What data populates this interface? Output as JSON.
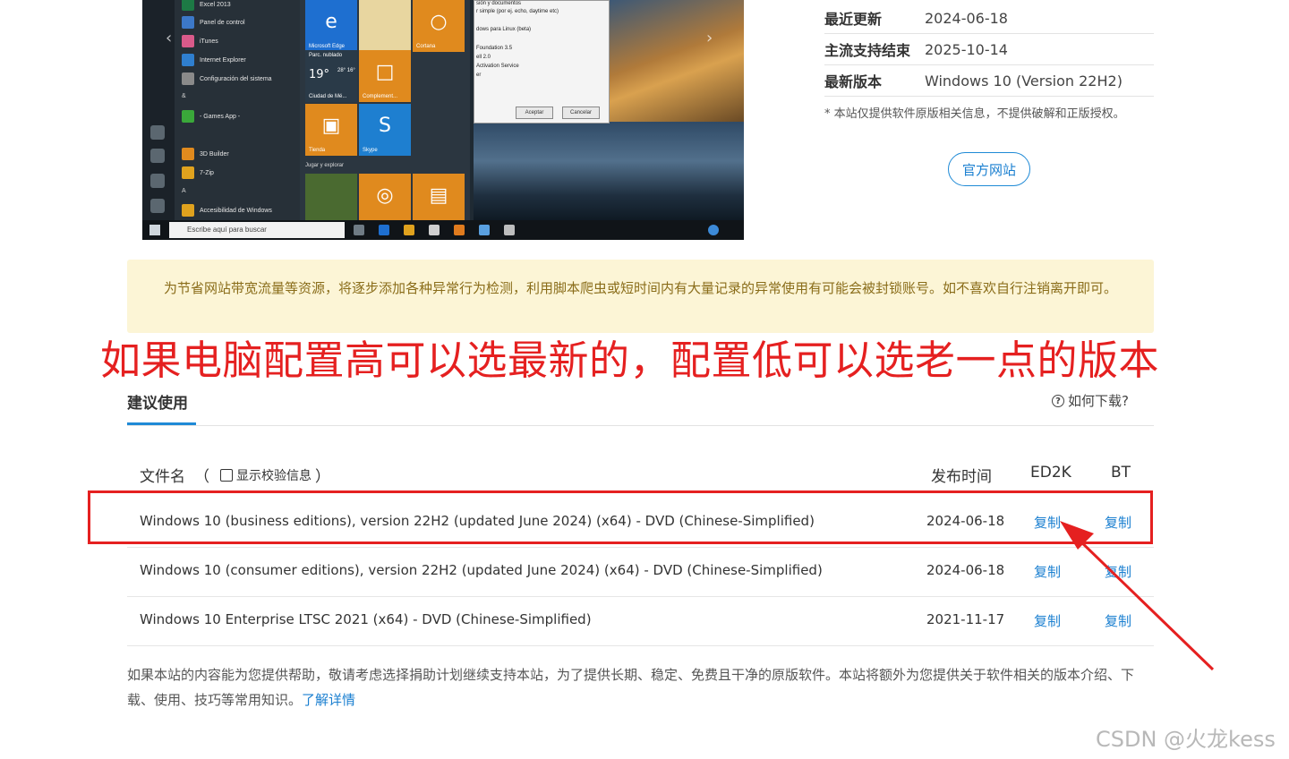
{
  "screenshot": {
    "apps": [
      {
        "label": "Excel 2013",
        "color": "#1d7a45"
      },
      {
        "label": "Panel de control",
        "color": "#3c78c8"
      },
      {
        "label": "iTunes",
        "color": "#d95a8a"
      },
      {
        "label": "Internet Explorer",
        "color": "#2f7fcf"
      },
      {
        "label": "Configuración del sistema",
        "color": "#8a8a8a"
      },
      {
        "label": "- Games App -",
        "color": "#3aa83a"
      },
      {
        "label": "3D Builder",
        "color": "#e08a1e"
      },
      {
        "label": "7-Zip",
        "color": "#e0a21e"
      },
      {
        "label": "Accesibilidad de Windows",
        "color": "#e0a21e"
      }
    ],
    "letters": [
      "&",
      "A"
    ],
    "tiles": [
      {
        "label": "Microsoft Edge",
        "glyph": "e",
        "color": "#1e6fd0"
      },
      {
        "label": "",
        "glyph": "",
        "color": "#e8d6a0"
      },
      {
        "label": "Cortana",
        "glyph": "○",
        "color": "#e08a1e"
      },
      {
        "label": "Ciudad de Mé...",
        "glyph": "19°",
        "color": "#2a3a48"
      },
      {
        "label": "Complement...",
        "glyph": "□",
        "color": "#e08a1e"
      },
      {
        "label": "Tienda",
        "glyph": "▣",
        "color": "#e08a1e"
      },
      {
        "label": "Skype",
        "glyph": "S",
        "color": "#1e7fd0"
      },
      {
        "label": "",
        "glyph": "",
        "color": "#4a6a30"
      },
      {
        "label": "",
        "glyph": "◎",
        "color": "#e08a1e"
      },
      {
        "label": "",
        "glyph": "▤",
        "color": "#e08a1e"
      }
    ],
    "weather_heading": "Parc. nublado",
    "weather_hi_lo": "28° 16°",
    "group_label": "Jugar y explorar",
    "dialog_lines": [
      "sión y documentos",
      "r simple (por ej. echo, daytime etc)",
      "",
      "dows para Linux (beta)",
      "",
      "Foundation 3.5",
      "ell 2.0",
      "Activation Service",
      "er"
    ],
    "dialog_accept": "Aceptar",
    "dialog_cancel": "Cancelar",
    "taskbar_search": "Escribe aquí para buscar"
  },
  "info": [
    {
      "key": "最近更新",
      "value": "2024-06-18"
    },
    {
      "key": "主流支持结束",
      "value": "2025-10-14"
    },
    {
      "key": "最新版本",
      "value": "Windows 10 (Version 22H2)"
    }
  ],
  "note": "* 本站仅提供软件原版相关信息，不提供破解和正版授权。",
  "official_site": "官方网站",
  "banner": "为节省网站带宽流量等资源，将逐步添加各种异常行为检测，利用脚本爬虫或短时间内有大量记录的异常使用有可能会被封锁账号。如不喜欢自行注销离开即可。",
  "annotation": "如果电脑配置高可以选最新的，配置低可以选老一点的版本",
  "section_title": "建议使用",
  "how_to": "如何下载?",
  "table": {
    "col_file": "文件名",
    "paren_open": "（",
    "show_checksum": "显示校验信息",
    "paren_close": "）",
    "col_date": "发布时间",
    "col_ed2k": "ED2K",
    "col_bt": "BT",
    "rows": [
      {
        "name": "Windows 10 (business editions), version 22H2 (updated June 2024) (x64) - DVD (Chinese-Simplified)",
        "date": "2024-06-18",
        "ed2k": "复制",
        "bt": "复制"
      },
      {
        "name": "Windows 10 (consumer editions), version 22H2 (updated June 2024) (x64) - DVD (Chinese-Simplified)",
        "date": "2024-06-18",
        "ed2k": "复制",
        "bt": "复制"
      },
      {
        "name": "Windows 10 Enterprise LTSC 2021 (x64) - DVD (Chinese-Simplified)",
        "date": "2021-11-17",
        "ed2k": "复制",
        "bt": "复制"
      }
    ]
  },
  "footer": {
    "text": "如果本站的内容能为您提供帮助，敬请考虑选择捐助计划继续支持本站，为了提供长期、稳定、免费且干净的原版软件。本站将额外为您提供关于软件相关的版本介绍、下载、使用、技巧等常用知识。",
    "link": "了解详情"
  },
  "watermark": "CSDN @火龙kess",
  "colors": {
    "accent": "#1f8ad6",
    "annotation": "#e52020",
    "banner_bg": "#fcf5d6"
  }
}
